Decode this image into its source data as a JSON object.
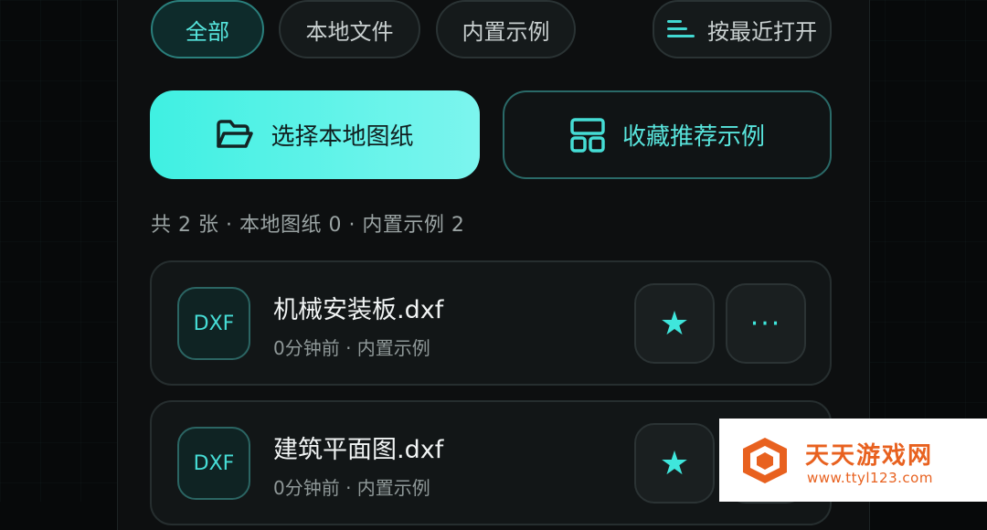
{
  "filters": {
    "tabs": [
      {
        "label": "全部"
      },
      {
        "label": "本地文件"
      },
      {
        "label": "内置示例"
      }
    ],
    "sort_label": "按最近打开"
  },
  "actions": {
    "primary_label": "选择本地图纸",
    "secondary_label": "收藏推荐示例"
  },
  "summary": "共 2 张 · 本地图纸 0 · 内置示例 2",
  "files": [
    {
      "type": "DXF",
      "name": "机械安装板.dxf",
      "meta": "0分钟前 · 内置示例"
    },
    {
      "type": "DXF",
      "name": "建筑平面图.dxf",
      "meta": "0分钟前 · 内置示例"
    }
  ],
  "icons": {
    "star": "★",
    "more": "···"
  },
  "watermark": {
    "title": "天天游戏网",
    "url": "www.ttyl123.com"
  },
  "colors": {
    "accent": "#3ff0e2",
    "background": "#0d0f10",
    "watermark": "#e8611f"
  }
}
